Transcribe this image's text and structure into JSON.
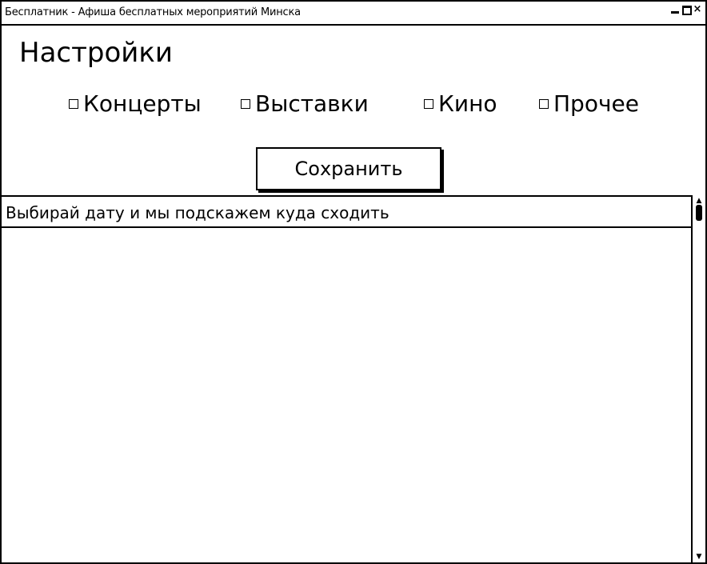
{
  "window": {
    "title": "Бесплатник - Афиша бесплатных мероприятий Минска",
    "controls": {
      "minimize": "minimize-icon",
      "maximize": "maximize-icon",
      "close": "×"
    }
  },
  "settings": {
    "title": "Настройки",
    "categories": [
      {
        "label": "Концерты",
        "checked": false
      },
      {
        "label": "Выставки",
        "checked": false
      },
      {
        "label": "Кино",
        "checked": false
      },
      {
        "label": "Прочее",
        "checked": false
      }
    ],
    "save_label": "Сохранить"
  },
  "events": {
    "hint": "Выбирай дату и мы подскажем куда сходить",
    "items": []
  },
  "scrollbar": {
    "up": "▲",
    "down": "▼"
  }
}
